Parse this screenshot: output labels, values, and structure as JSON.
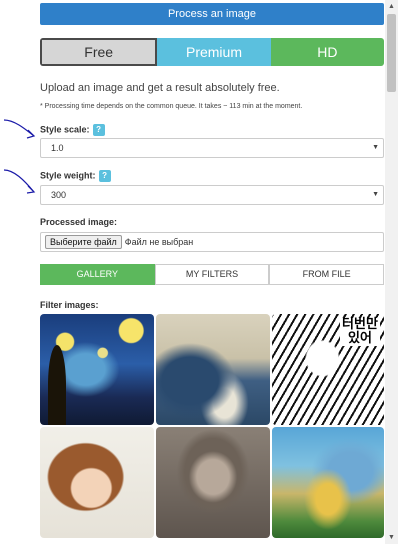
{
  "header": {
    "process_label": "Process an image"
  },
  "modes": [
    {
      "label": "Free",
      "state": "selected"
    },
    {
      "label": "Premium",
      "state": "normal"
    },
    {
      "label": "HD",
      "state": "normal"
    }
  ],
  "intro": "Upload an image and get a result absolutely free.",
  "note": "* Processing time depends on the common queue. It takes ~ 113 min at the moment.",
  "style_scale": {
    "label": "Style scale:",
    "help": "?",
    "value": "1.0"
  },
  "style_weight": {
    "label": "Style weight:",
    "help": "?",
    "value": "300"
  },
  "processed_image": {
    "label": "Processed image:",
    "file_button": "Выберите файл",
    "file_status": "Файл не выбран"
  },
  "tabs": [
    {
      "label": "GALLERY",
      "active": true
    },
    {
      "label": "MY FILTERS",
      "active": false
    },
    {
      "label": "FROM FILE",
      "active": false
    }
  ],
  "filter_label": "Filter images:",
  "filters": [
    {
      "name": "starry-night"
    },
    {
      "name": "great-wave"
    },
    {
      "name": "manga",
      "text": "터번만 있어"
    },
    {
      "name": "cartoon-girl"
    },
    {
      "name": "portrait-sketch"
    },
    {
      "name": "watercolor-landscape"
    }
  ],
  "colors": {
    "primary": "#2f80c9",
    "info": "#5bc0de",
    "success": "#5cb85c",
    "annotation": "#1a1aa8"
  },
  "icons": {
    "caret": "▼",
    "scroll_up": "▲",
    "scroll_down": "▼"
  }
}
